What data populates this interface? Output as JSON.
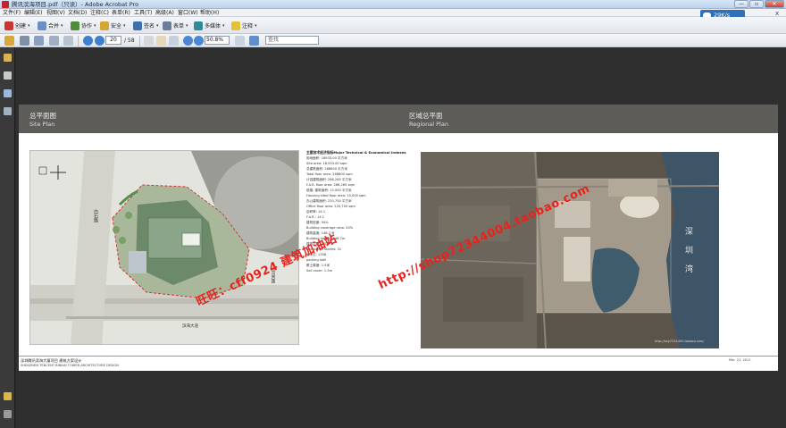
{
  "window": {
    "title": "腾讯滨海项目.pdf（只读）- Adobe Acrobat Pro",
    "controls": [
      "—",
      "▫",
      "✕"
    ]
  },
  "menu": [
    "文件(F)",
    "编辑(E)",
    "视图(V)",
    "文档(D)",
    "注释(C)",
    "表单(R)",
    "工具(T)",
    "高级(A)",
    "窗口(W)",
    "帮助(H)"
  ],
  "network_badge": "29K/s",
  "close_doc": "x",
  "toolbar1": {
    "create": "创建",
    "combine": "合并",
    "collaborate": "协作",
    "secure": "安全",
    "sign": "签名",
    "forms": "表单",
    "multimedia": "多媒体",
    "comment": "注释"
  },
  "toolbar2": {
    "page_current": "20",
    "page_total": "/ 58",
    "zoom": "50.8%",
    "find_placeholder": "查找"
  },
  "document": {
    "left_title_cn": "总平面图",
    "left_title_en": "Site  Plan",
    "right_title_cn": "区域总平面",
    "right_title_en": "Regional  Plan",
    "notes_heading": "主要技术经济指标Major Technical & Economical Indexes",
    "notes": [
      "用地面积: 18933.00 平方米",
      "Site area: 18,933.00 sqm",
      "总建筑面积: 268600 平方米",
      "Total floor area: 268600 sqm",
      "计容建筑面积: 266,265 平方米",
      "F.A.R. floor area: 266,265 sqm",
      "塔楼: 建筑面积: 15,000 平方米",
      "Housing sited floor area: 15,000 sqm",
      "办公建筑面积: 220,700 平方米",
      "Office floor area: 220,700 sqm",
      "容积率: 14.1",
      "F.A.R.: 14.1",
      "建筑密度: 54%",
      "Building coverage ratio: 54%",
      "建筑高度: 148.7 米",
      "Building height: 148.7m",
      "建筑层数: 31层",
      "Number of stories: 31",
      "停车位: 1358",
      "parking stall",
      "覆土厚度: 1.5米",
      "Soil cover: 1.5m"
    ],
    "water_label": [
      "深",
      "圳",
      "湾"
    ],
    "road_labels": [
      "沙河西路",
      "滨海大道",
      "白石路"
    ],
    "aerial_credit": "http://sxp7234400.taobao.com/",
    "footer_cn": "深圳腾讯滨海大厦项目 建筑方案设计",
    "footer_en": "SHENZHEN TENCENT BINHAI TOWER ARCHITECTURE DESIGN",
    "footer_date": "Mar. 21, 2011"
  },
  "watermark": {
    "line1": "旺旺：cff0924  建筑加油站",
    "line2": "http://shop72344004.taobao.com"
  },
  "colors": {
    "workspace": "#2f2f2f",
    "page_header": "#5e5c59",
    "watermark": "#e8231d",
    "title_bar": "#bcd2ec"
  }
}
